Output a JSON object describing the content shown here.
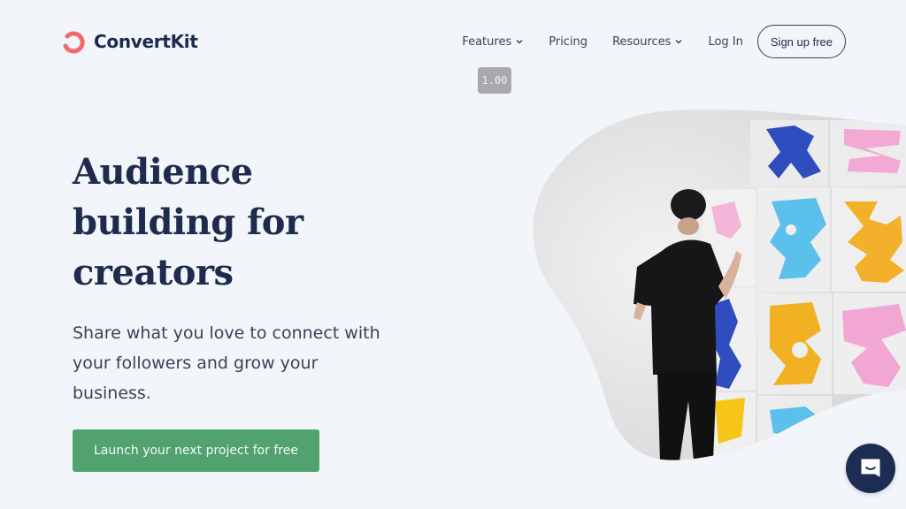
{
  "brand": {
    "name": "ConvertKit",
    "logo_icon": "convertkit-swirl-icon",
    "logo_color": "#ef6b6b"
  },
  "nav": {
    "items": [
      {
        "label": "Features",
        "has_dropdown": true
      },
      {
        "label": "Pricing",
        "has_dropdown": false
      },
      {
        "label": "Resources",
        "has_dropdown": true
      },
      {
        "label": "Log In",
        "has_dropdown": false
      }
    ],
    "signup_label": "Sign up free"
  },
  "zoom_indicator": "1.00",
  "hero": {
    "headline": "Audience building for creators",
    "subtext": "Share what you love to connect with your followers and grow your business.",
    "cta_label": "Launch your next project for free",
    "image_alt": "Artist painting colorful shapes on paper sheets pinned to a wall"
  },
  "chat": {
    "icon": "chat-bubble-icon"
  },
  "colors": {
    "background": "#f2f5f9",
    "text_dark": "#1f2b4d",
    "cta_green": "#51a26f",
    "chat_navy": "#1d2d52",
    "zoom_badge": "#a8a9ab"
  }
}
